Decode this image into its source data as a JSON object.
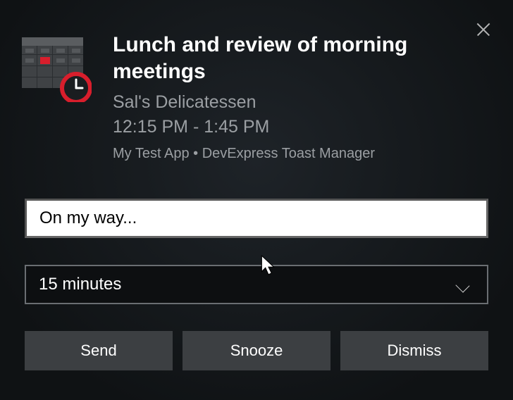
{
  "title": "Lunch and review of morning meetings",
  "location": "Sal's Delicatessen",
  "time": "12:15 PM - 1:45 PM",
  "attribution": "My Test App • DevExpress Toast Manager",
  "input": {
    "value": "On my way...",
    "placeholder": ""
  },
  "snooze_select": {
    "selected": "15 minutes"
  },
  "buttons": {
    "send": "Send",
    "snooze": "Snooze",
    "dismiss": "Dismiss"
  }
}
